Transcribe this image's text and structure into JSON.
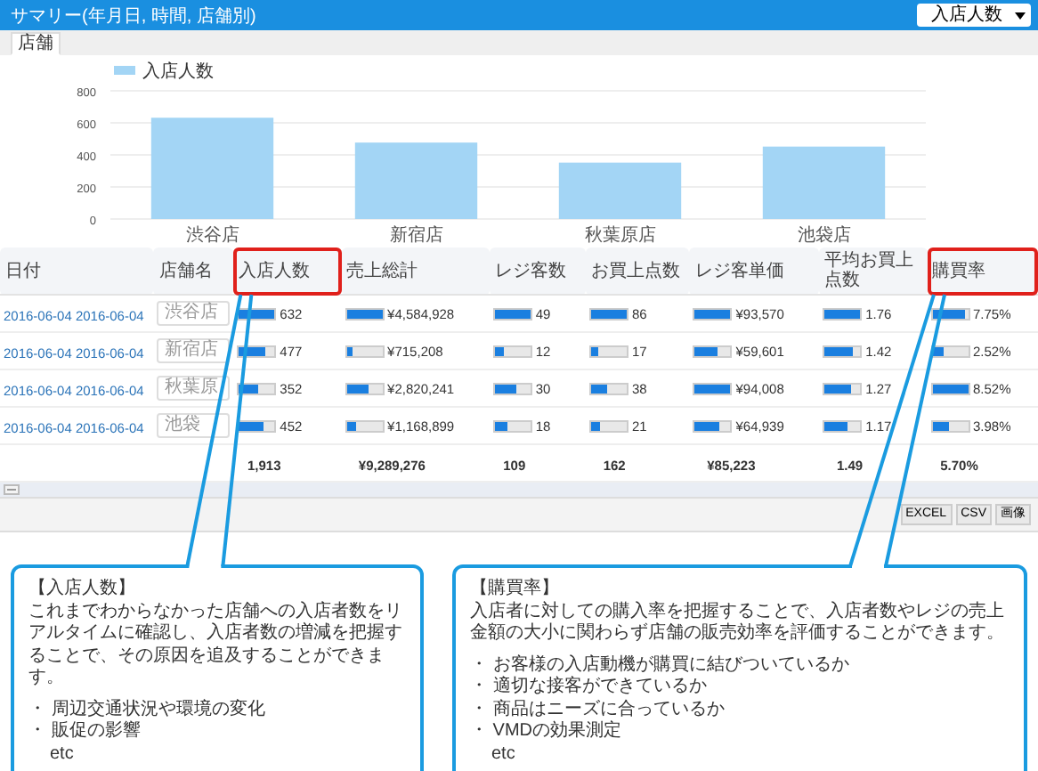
{
  "window": {
    "title": "サマリー(年月日, 時間, 店舗別)"
  },
  "metric_select": {
    "value": "入店人数"
  },
  "tabs": [
    {
      "label": "店舗",
      "selected": true
    }
  ],
  "chart": {
    "chart_data": {
      "type": "bar",
      "categories": [
        "渋谷店",
        "新宿店",
        "秋葉原店",
        "池袋店"
      ],
      "series": [
        {
          "name": "入店人数",
          "color": "#a3d5f5",
          "values": [
            632,
            477,
            352,
            452
          ]
        }
      ],
      "ylim": [
        0,
        800
      ],
      "grid": true,
      "yticks": [
        0,
        200,
        400,
        600,
        800
      ]
    }
  },
  "table": {
    "columns": [
      {
        "label": "日付",
        "highlighted": false
      },
      {
        "label": "店舗名",
        "highlighted": false
      },
      {
        "label": "入店人数",
        "highlighted": true
      },
      {
        "label": "売上総計",
        "highlighted": false
      },
      {
        "label": "レジ客数",
        "highlighted": false
      },
      {
        "label": "お買上点数",
        "highlighted": false
      },
      {
        "label": "レジ客単価",
        "highlighted": false
      },
      {
        "label": "平均お買上点数",
        "highlighted": false
      },
      {
        "label": "購買率",
        "highlighted": true
      }
    ],
    "rows": [
      {
        "date": "2016-06-04 2016-06-04",
        "store": "渋谷店",
        "metrics": [
          {
            "value": "632",
            "level": 1
          },
          {
            "value": "¥4,584,928",
            "level": 1
          },
          {
            "value": "49",
            "level": 1
          },
          {
            "value": "86",
            "level": 1
          },
          {
            "value": "¥93,570",
            "level": 1
          },
          {
            "value": "1.76",
            "level": 1
          },
          {
            "value": "7.75%",
            "level": 0.9
          }
        ]
      },
      {
        "date": "2016-06-04 2016-06-04",
        "store": "新宿店",
        "metrics": [
          {
            "value": "477",
            "level": 0.75
          },
          {
            "value": "¥715,208",
            "level": 0.15
          },
          {
            "value": "12",
            "level": 0.25
          },
          {
            "value": "17",
            "level": 0.2
          },
          {
            "value": "¥59,601",
            "level": 0.63
          },
          {
            "value": "1.42",
            "level": 0.8
          },
          {
            "value": "2.52%",
            "level": 0.3
          }
        ]
      },
      {
        "date": "2016-06-04 2016-06-04",
        "store": "秋葉原",
        "metrics": [
          {
            "value": "352",
            "level": 0.55
          },
          {
            "value": "¥2,820,241",
            "level": 0.6
          },
          {
            "value": "30",
            "level": 0.6
          },
          {
            "value": "38",
            "level": 0.45
          },
          {
            "value": "¥94,008",
            "level": 1
          },
          {
            "value": "1.27",
            "level": 0.72
          },
          {
            "value": "8.52%",
            "level": 1
          }
        ]
      },
      {
        "date": "2016-06-04 2016-06-04",
        "store": "池袋",
        "metrics": [
          {
            "value": "452",
            "level": 0.7
          },
          {
            "value": "¥1,168,899",
            "level": 0.25
          },
          {
            "value": "18",
            "level": 0.35
          },
          {
            "value": "21",
            "level": 0.25
          },
          {
            "value": "¥64,939",
            "level": 0.7
          },
          {
            "value": "1.17",
            "level": 0.66
          },
          {
            "value": "3.98%",
            "level": 0.47
          }
        ]
      }
    ],
    "totals": [
      "1,913",
      "¥9,289,276",
      "109",
      "162",
      "¥85,223",
      "1.49",
      "5.70%"
    ]
  },
  "export_buttons": [
    "EXCEL",
    "CSV",
    "画像"
  ],
  "callouts": [
    {
      "title": "【入店人数】",
      "text": "これまでわからなかった店舗への入店者数をリアルタイムに確認し、入店者数の増減を把握することで、その原因を追及することができます。",
      "bullets": [
        "・ 周辺交通状況や環境の変化",
        "・ 販促の影響"
      ],
      "note": "etc"
    },
    {
      "title": "【購買率】",
      "text": "入店者に対しての購入率を把握することで、入店者数やレジの売上金額の大小に関わらず店舗の販売効率を評価することができます。",
      "bullets": [
        "・ お客様の入店動機が購買に結びついているか",
        "・ 適切な接客ができているか",
        "・ 商品はニーズに合っているか",
        "・ VMDの効果測定"
      ],
      "note": "etc"
    }
  ]
}
